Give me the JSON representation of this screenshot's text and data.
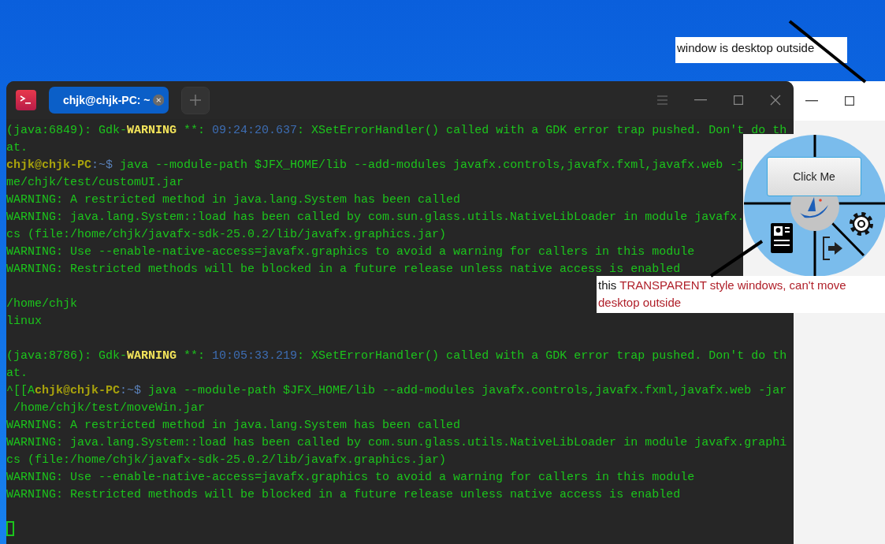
{
  "annotations": [
    {
      "kind": "top",
      "parts": [
        {
          "kind": "plain",
          "text": "window is desktop outside"
        }
      ]
    },
    {
      "kind": "side",
      "parts": [
        {
          "kind": "plain",
          "text": "this "
        },
        {
          "kind": "alert",
          "text": "TRANSPARENT style windows, can't move desktop outside"
        }
      ]
    }
  ],
  "terminal": {
    "tab": {
      "title": "chjk@chjk-PC: ~",
      "selected": true
    },
    "lines": [
      {
        "kind": "text",
        "segments": [
          {
            "kind": "plain",
            "text": "(java:6849): Gdk-"
          },
          {
            "kind": "warn",
            "text": "WARNING"
          },
          {
            "kind": "plain",
            "text": " **: "
          },
          {
            "kind": "time",
            "text": "09:24:20.637"
          },
          {
            "kind": "plain",
            "text": ": XSetErrorHandler() called with a GDK error trap pushed. Don't do th"
          }
        ]
      },
      {
        "kind": "text",
        "segments": [
          {
            "kind": "plain",
            "text": "at."
          }
        ]
      },
      {
        "kind": "text",
        "segments": [
          {
            "kind": "user",
            "text": "chjk@chjk-PC"
          },
          {
            "kind": "path",
            "text": ":~$"
          },
          {
            "kind": "plain",
            "text": " java --module-path $JFX_HOME/lib --add-modules javafx.controls,javafx.fxml,javafx.web -j"
          }
        ]
      },
      {
        "kind": "text",
        "segments": [
          {
            "kind": "plain",
            "text": "me/chjk/test/customUI.jar"
          }
        ]
      },
      {
        "kind": "text",
        "segments": [
          {
            "kind": "plain",
            "text": "WARNING: A restricted method in java.lang.System has been called"
          }
        ]
      },
      {
        "kind": "text",
        "segments": [
          {
            "kind": "plain",
            "text": "WARNING: java.lang.System::load has been called by com.sun.glass.utils.NativeLibLoader in module javafx."
          }
        ]
      },
      {
        "kind": "text",
        "segments": [
          {
            "kind": "plain",
            "text": "cs (file:/home/chjk/javafx-sdk-25.0.2/lib/javafx.graphics.jar)"
          }
        ]
      },
      {
        "kind": "text",
        "segments": [
          {
            "kind": "plain",
            "text": "WARNING: Use --enable-native-access=javafx.graphics to avoid a warning for callers in this module"
          }
        ]
      },
      {
        "kind": "text",
        "segments": [
          {
            "kind": "plain",
            "text": "WARNING: Restricted methods will be blocked in a future release unless native access is enabled"
          }
        ]
      },
      {
        "kind": "blank"
      },
      {
        "kind": "text",
        "segments": [
          {
            "kind": "plain",
            "text": "/home/chjk"
          }
        ]
      },
      {
        "kind": "text",
        "segments": [
          {
            "kind": "plain",
            "text": "linux"
          }
        ]
      },
      {
        "kind": "blank"
      },
      {
        "kind": "text",
        "segments": [
          {
            "kind": "plain",
            "text": "(java:8786): Gdk-"
          },
          {
            "kind": "warn",
            "text": "WARNING"
          },
          {
            "kind": "plain",
            "text": " **: "
          },
          {
            "kind": "time",
            "text": "10:05:33.219"
          },
          {
            "kind": "plain",
            "text": ": XSetErrorHandler() called with a GDK error trap pushed. Don't do th"
          }
        ]
      },
      {
        "kind": "text",
        "segments": [
          {
            "kind": "plain",
            "text": "at."
          }
        ]
      },
      {
        "kind": "text",
        "segments": [
          {
            "kind": "plain",
            "text": "^[[A"
          },
          {
            "kind": "user",
            "text": "chjk@chjk-PC"
          },
          {
            "kind": "path",
            "text": ":~$"
          },
          {
            "kind": "plain",
            "text": " java --module-path $JFX_HOME/lib --add-modules javafx.controls,javafx.fxml,javafx.web -jar"
          }
        ]
      },
      {
        "kind": "text",
        "segments": [
          {
            "kind": "plain",
            "text": " /home/chjk/test/moveWin.jar"
          }
        ]
      },
      {
        "kind": "text",
        "segments": [
          {
            "kind": "plain",
            "text": "WARNING: A restricted method in java.lang.System has been called"
          }
        ]
      },
      {
        "kind": "text",
        "segments": [
          {
            "kind": "plain",
            "text": "WARNING: java.lang.System::load has been called by com.sun.glass.utils.NativeLibLoader in module javafx.graphi"
          }
        ]
      },
      {
        "kind": "text",
        "segments": [
          {
            "kind": "plain",
            "text": "cs (file:/home/chjk/javafx-sdk-25.0.2/lib/javafx.graphics.jar)"
          }
        ]
      },
      {
        "kind": "text",
        "segments": [
          {
            "kind": "plain",
            "text": "WARNING: Use --enable-native-access=javafx.graphics to avoid a warning for callers in this module"
          }
        ]
      },
      {
        "kind": "text",
        "segments": [
          {
            "kind": "plain",
            "text": "WARNING: Restricted methods will be blocked in a future release unless native access is enabled"
          }
        ]
      },
      {
        "kind": "blank"
      },
      {
        "kind": "cursor"
      }
    ]
  },
  "widget": {
    "button": "Click Me"
  }
}
